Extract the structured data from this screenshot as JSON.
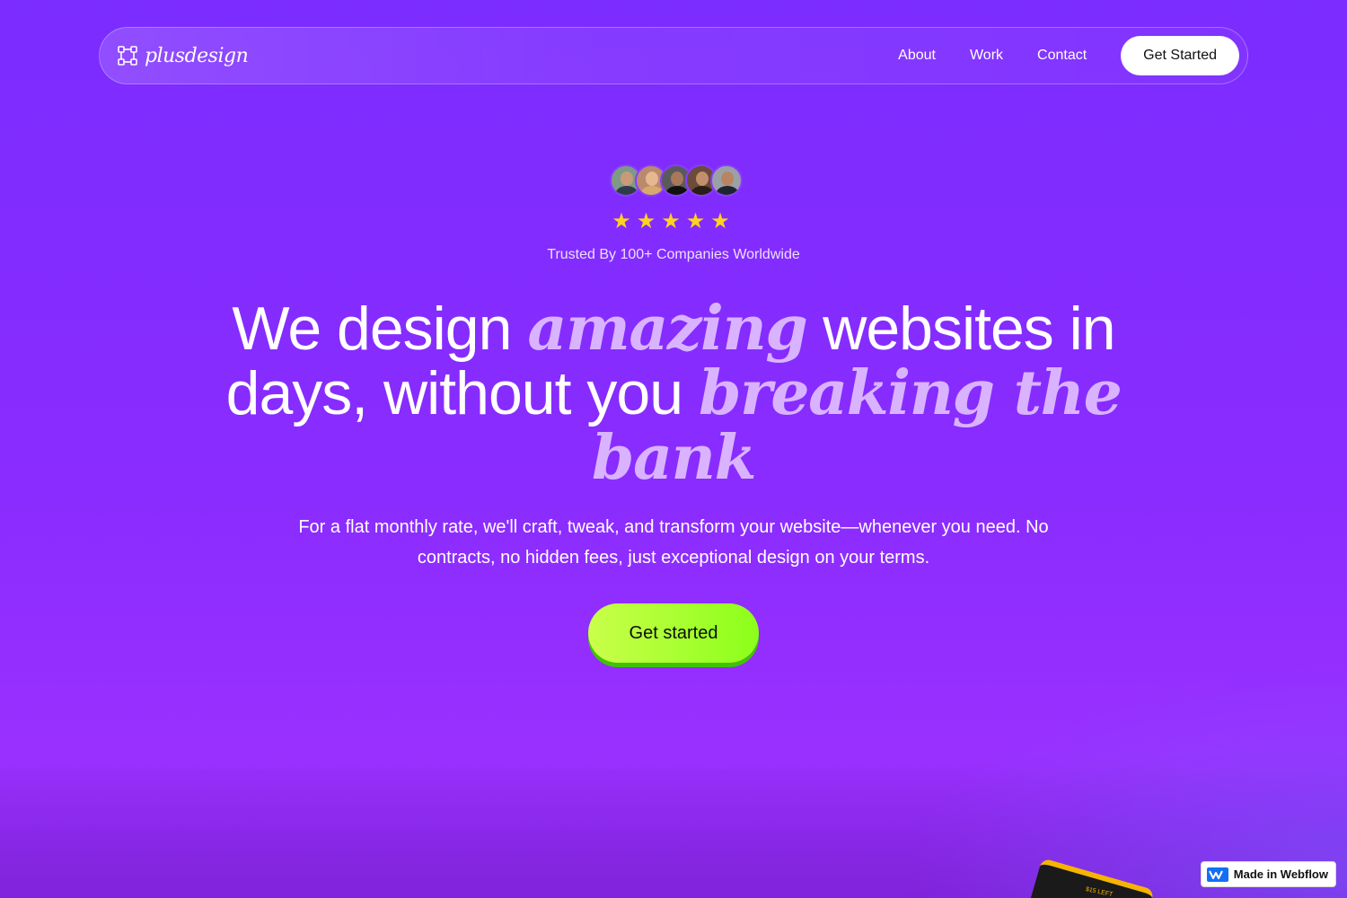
{
  "nav": {
    "brand_name": "plusdesign",
    "links": [
      "About",
      "Work",
      "Contact"
    ],
    "cta_label": "Get Started"
  },
  "hero": {
    "avatar_count": 5,
    "rating": 5,
    "stars_text": "★★★★★",
    "trusted_text": "Trusted By 100+ Companies Worldwide",
    "headline_part1": "We design ",
    "headline_accent1": "amazing",
    "headline_part2": " websites in days, without you ",
    "headline_accent2": "breaking the bank",
    "subtext": "For a flat monthly rate, we'll craft, tweak, and transform your website—whenever you need. No contracts, no hidden fees, just exceptional design on your terms.",
    "cta_label": "Get started"
  },
  "peek_card": {
    "label": "$15 LEFT"
  },
  "badge": {
    "label": "Made in Webflow"
  },
  "colors": {
    "background": "#8a2cff",
    "accent_text": "#d9b3ff",
    "cta_green": "#8cff1a",
    "star": "#ffd21f"
  }
}
